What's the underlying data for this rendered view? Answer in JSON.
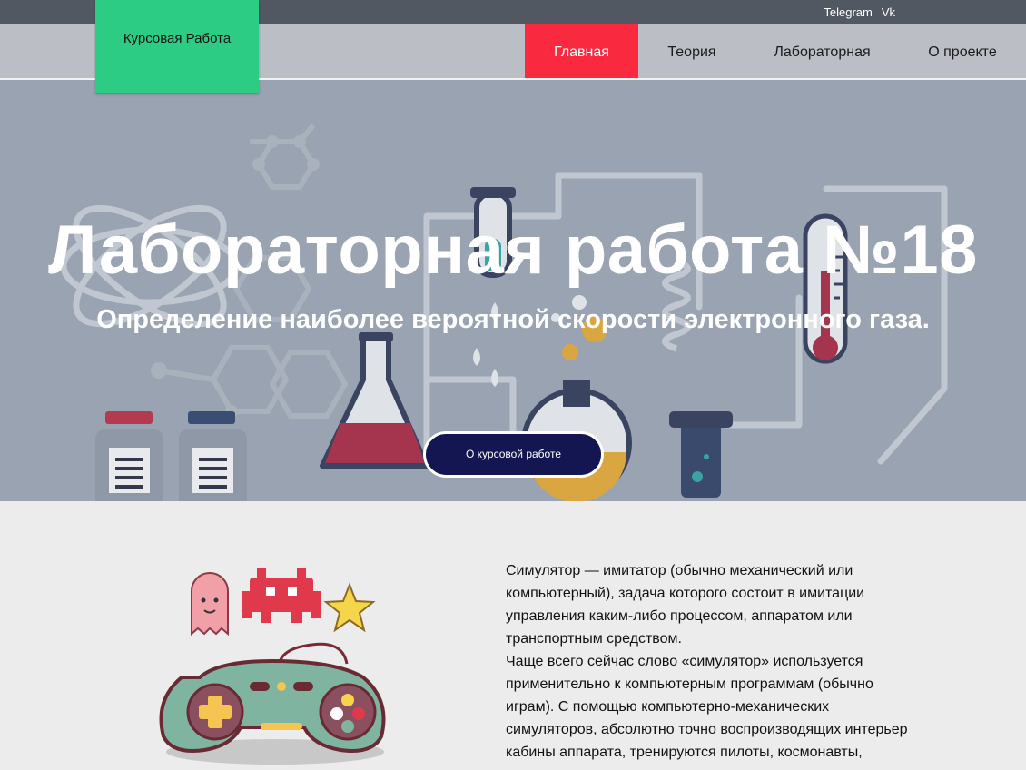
{
  "social": {
    "telegram": "Telegram",
    "vk": "Vk"
  },
  "brand": {
    "title": "Курсовая Работа",
    "color": "#2dcc85"
  },
  "nav": {
    "items": [
      "Главная",
      "Теория",
      "Лабораторная",
      "О проекте"
    ],
    "active_color": "#f92a40"
  },
  "hero": {
    "title": "Лабораторная работа №18",
    "subtitle": "Определение наиболее вероятной скорости электронного газа.",
    "button": "О курсовой работе"
  },
  "content": {
    "lines": [
      "Симулятор — имитатор (обычно механический или",
      "компьютерный), задача которого состоит в имитации",
      "управления каким-либо процессом, аппаратом или",
      "транспортным средством.",
      "Чаще всего сейчас слово «симулятор» используется",
      "применительно к компьютерным программам (обычно",
      "играм). С помощью компьютерно-механических",
      "симуляторов, абсолютно точно воспроизводящих интерьер",
      "кабины аппарата, тренируются пилоты, космонавты,"
    ]
  }
}
